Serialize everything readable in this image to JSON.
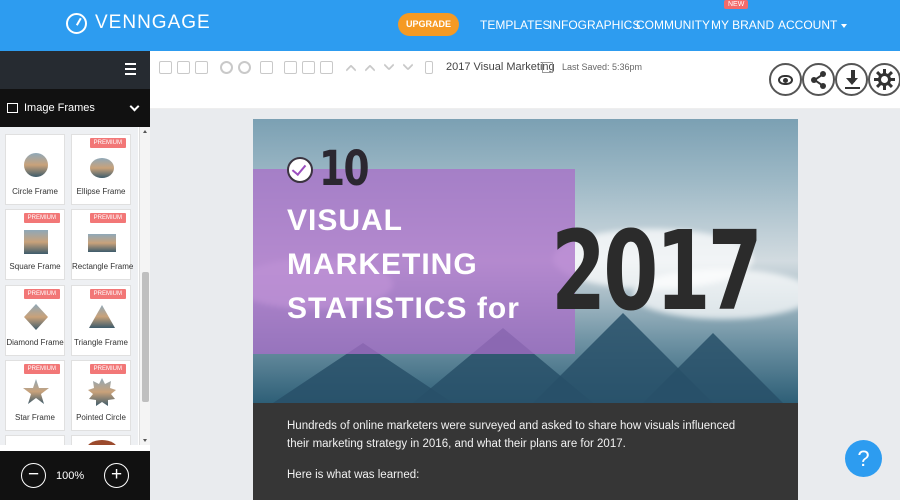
{
  "brand": {
    "name": "VENNGAGE",
    "accent": "#2d9cf0"
  },
  "header": {
    "upgrade_label": "UPGRADE",
    "nav": [
      "TEMPLATES",
      "INFOGRAPHICS",
      "COMMUNITY",
      "MY BRAND",
      "ACCOUNT"
    ],
    "new_badge": "NEW"
  },
  "sidebar": {
    "panel_title": "Image Frames",
    "premium_label": "PREMIUM",
    "tiles": [
      {
        "label": "Circle Frame",
        "premium": false
      },
      {
        "label": "Ellipse Frame",
        "premium": true
      },
      {
        "label": "Square Frame",
        "premium": true
      },
      {
        "label": "Rectangle Frame",
        "premium": true
      },
      {
        "label": "Diamond Frame",
        "premium": true
      },
      {
        "label": "Triangle Frame",
        "premium": true
      },
      {
        "label": "Star Frame",
        "premium": true
      },
      {
        "label": "Pointed Circle",
        "premium": true
      }
    ],
    "zoom": {
      "level": "100%",
      "minus": "−",
      "plus": "+"
    }
  },
  "toolbar": {
    "doc_title": "2017 Visual Marketing",
    "last_saved": "Last Saved: 5:36pm"
  },
  "canvas": {
    "number": "10",
    "headline_lines": [
      "VISUAL",
      "MARKETING",
      "STATISTICS for"
    ],
    "year": "2017",
    "paragraph": "Hundreds of online marketers were surveyed and asked to share how visuals influenced their marketing strategy in 2016, and what their plans are for 2017.",
    "paragraph2": "Here is what was learned:"
  },
  "help_label": "?"
}
